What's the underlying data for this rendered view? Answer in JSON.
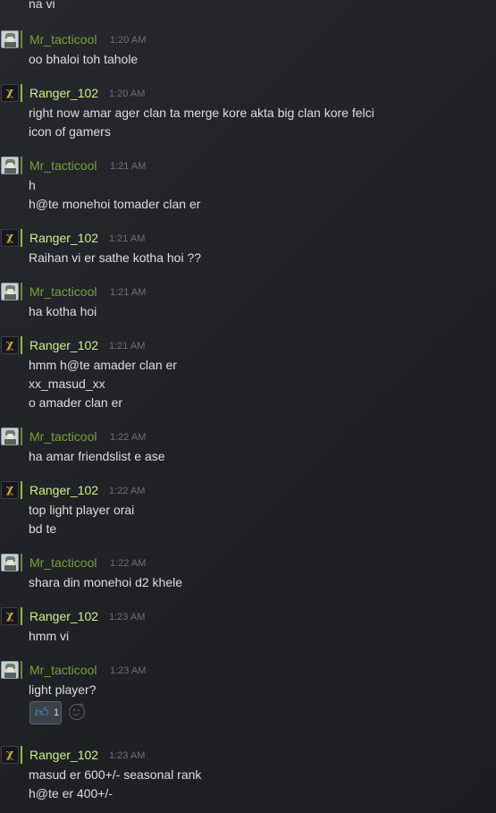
{
  "chat": {
    "top_partial": "na vi",
    "messages": [
      {
        "author": "Mr_tacticool",
        "time": "1:20 AM",
        "lines": [
          "oo bhaloi toh tahole"
        ]
      },
      {
        "author": "Ranger_102",
        "time": "1:20 AM",
        "lines": [
          "right now amar ager clan ta merge kore akta big clan kore felci",
          "icon of gamers"
        ]
      },
      {
        "author": "Mr_tacticool",
        "time": "1:21 AM",
        "lines": [
          "h",
          "h@te monehoi tomader clan er"
        ]
      },
      {
        "author": "Ranger_102",
        "time": "1:21 AM",
        "lines": [
          "Raihan vi er sathe kotha hoi ??"
        ]
      },
      {
        "author": "Mr_tacticool",
        "time": "1:21 AM",
        "lines": [
          "ha kotha hoi"
        ]
      },
      {
        "author": "Ranger_102",
        "time": "1:21 AM",
        "lines": [
          "hmm h@te amader clan er",
          "xx_masud_xx",
          "o amader clan er"
        ]
      },
      {
        "author": "Mr_tacticool",
        "time": "1:22 AM",
        "lines": [
          "ha amar friendslist e ase"
        ]
      },
      {
        "author": "Ranger_102",
        "time": "1:22 AM",
        "lines": [
          "top light player orai",
          "bd te"
        ]
      },
      {
        "author": "Mr_tacticool",
        "time": "1:22 AM",
        "lines": [
          "shara din monehoi d2 khele"
        ]
      },
      {
        "author": "Ranger_102",
        "time": "1:23 AM",
        "lines": [
          "hmm vi"
        ]
      },
      {
        "author": "Mr_tacticool",
        "time": "1:23 AM",
        "lines": [
          "light player?"
        ]
      },
      {
        "author": "Ranger_102",
        "time": "1:23 AM",
        "lines": [
          "masud er 600+/- seasonal rank",
          "h@te er 400+/-"
        ]
      }
    ],
    "reaction": {
      "icon": "thumbs-up-icon",
      "count": "1"
    },
    "add_reaction_icon": "add-reaction-icon",
    "colors": {
      "mr_name": "#78a13a",
      "ranger_name": "#d2f08a",
      "text": "#dcdedf",
      "timestamp": "#6d7178",
      "reaction_bg": "#3b4148"
    }
  }
}
